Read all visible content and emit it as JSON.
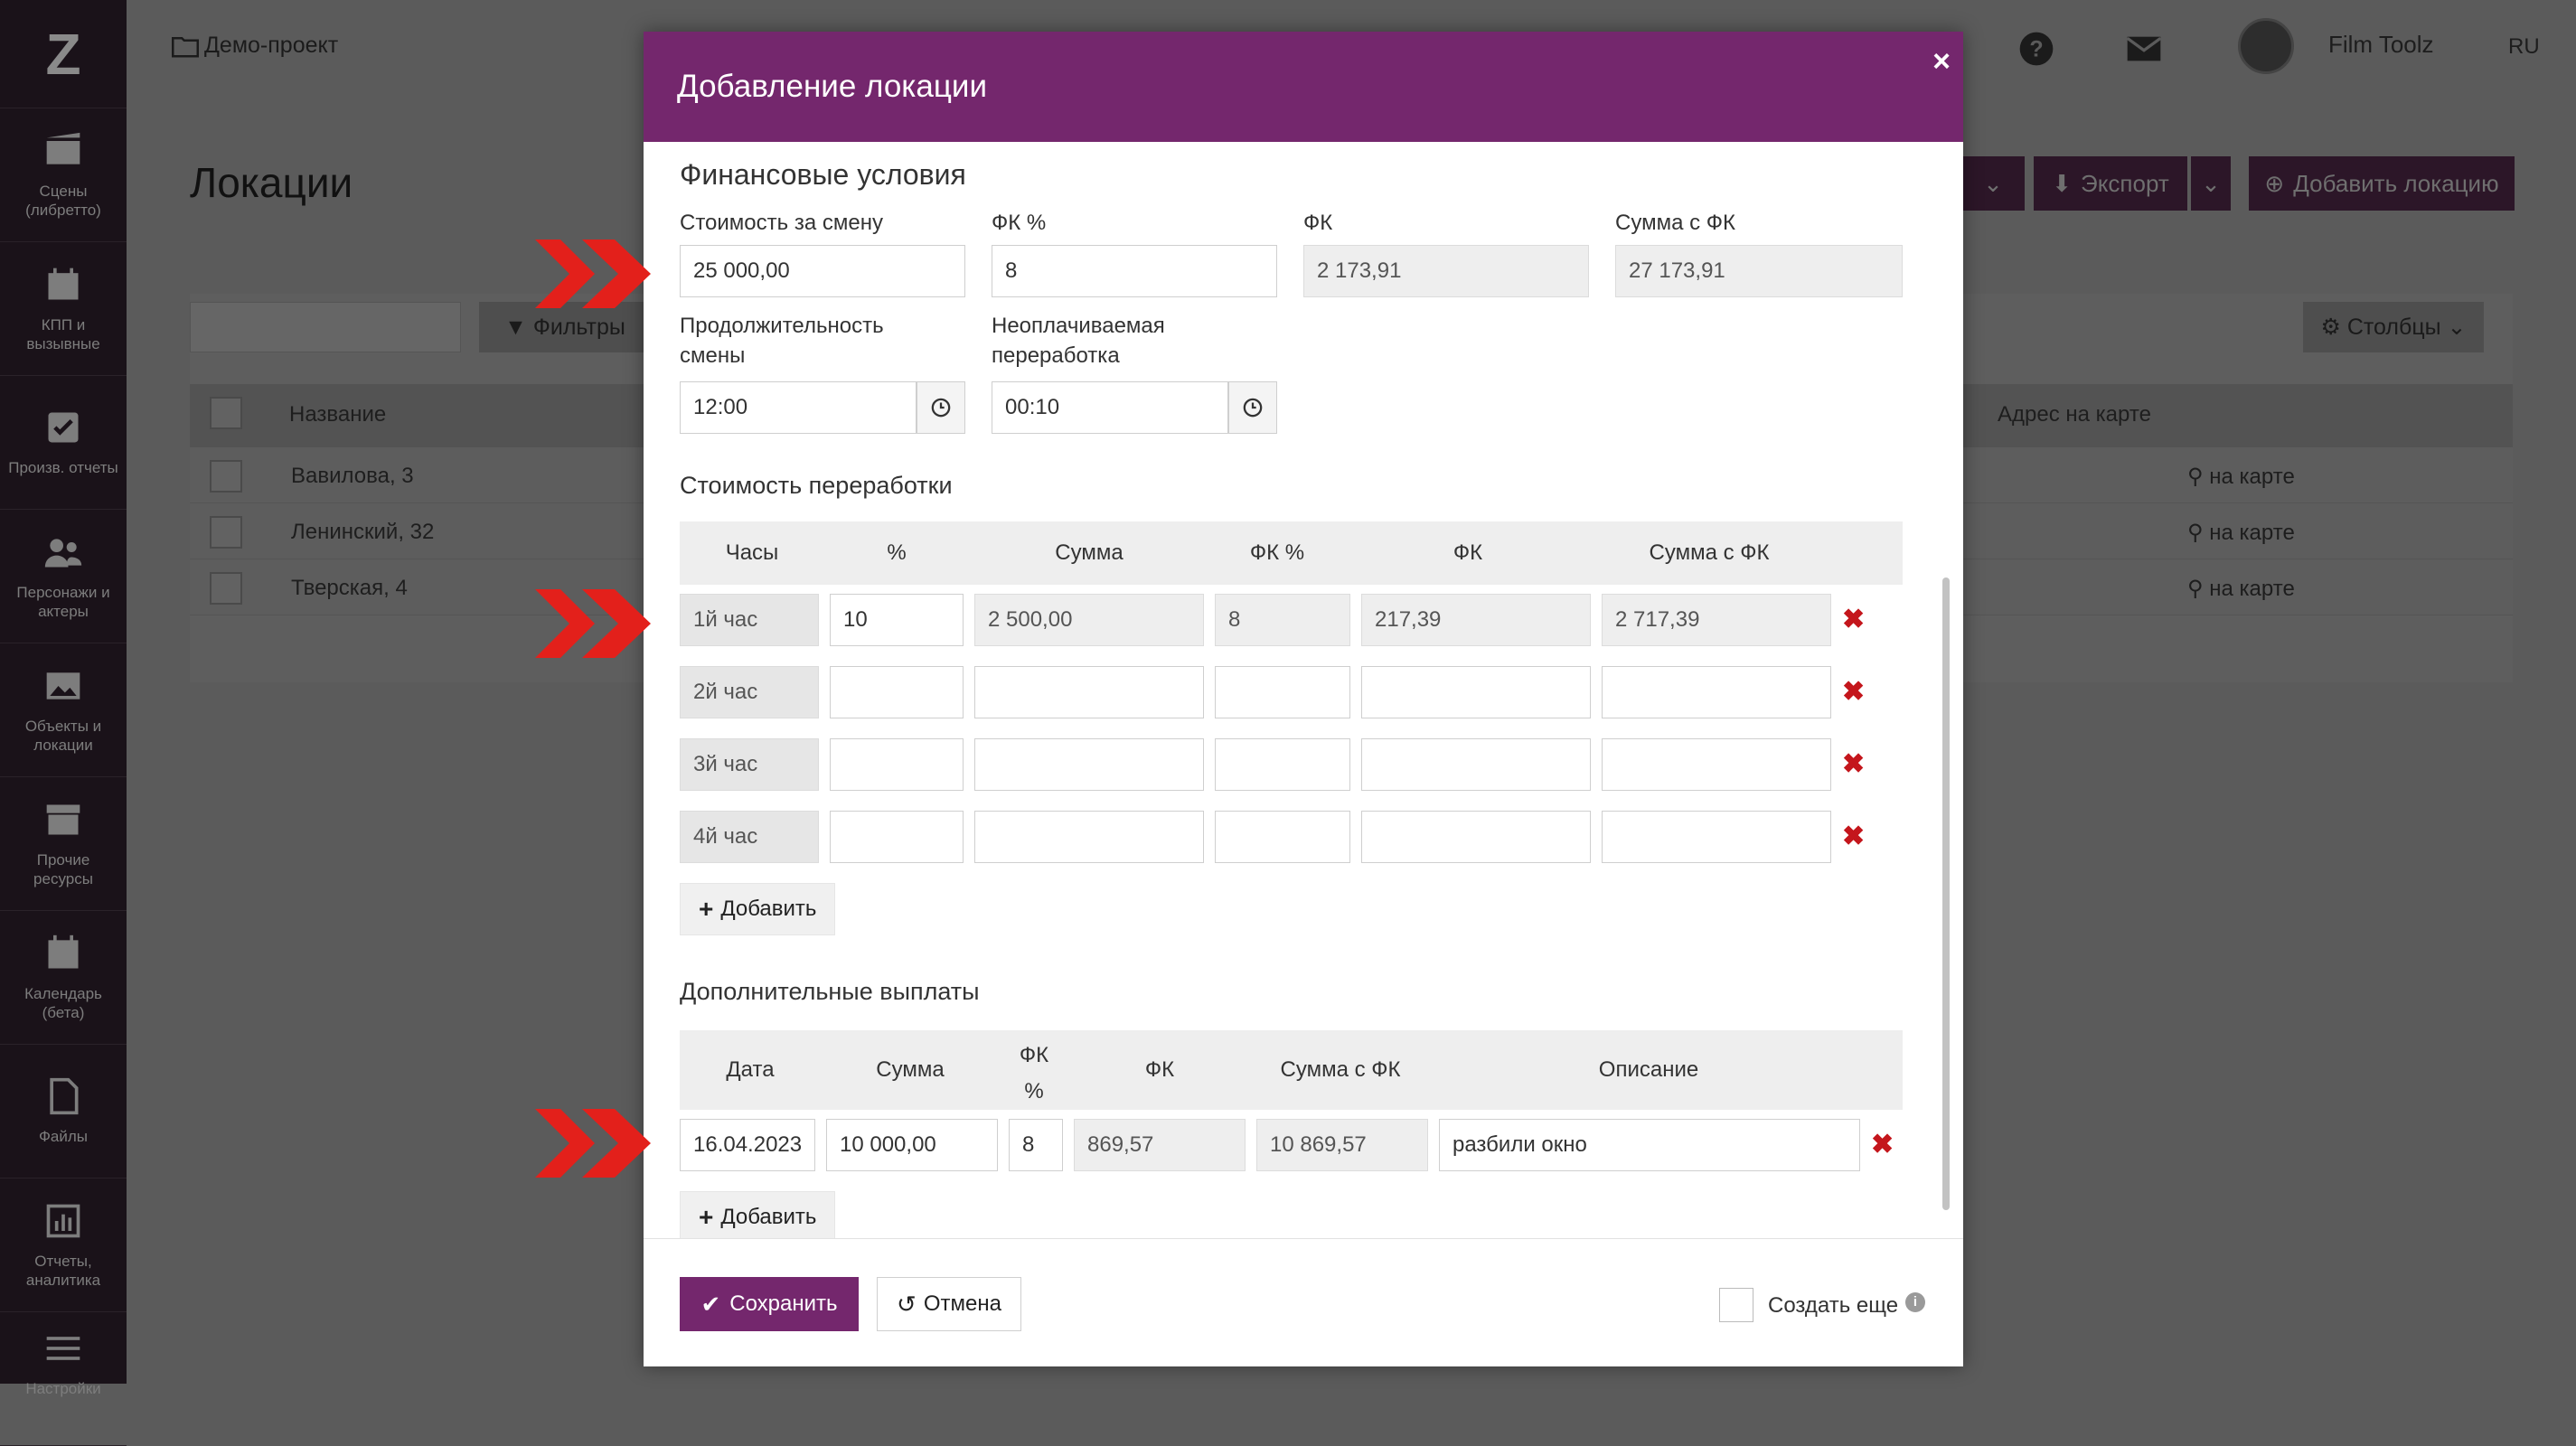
{
  "sidebar": {
    "logo": "Z",
    "items": [
      {
        "label": "Сцены (либретто)",
        "icon": "film-icon"
      },
      {
        "label": "КПП и вызывные",
        "icon": "calendar-icon"
      },
      {
        "label": "Произв. отчеты",
        "icon": "checkbox-icon"
      },
      {
        "label": "Персонажи и актеры",
        "icon": "users-icon"
      },
      {
        "label": "Объекты и локации",
        "icon": "image-icon"
      },
      {
        "label": "Прочие ресурсы",
        "icon": "archive-icon"
      },
      {
        "label": "Календарь (бета)",
        "icon": "calendar-grid-icon"
      },
      {
        "label": "Файлы",
        "icon": "file-icon"
      },
      {
        "label": "Отчеты, аналитика",
        "icon": "bar-chart-icon"
      },
      {
        "label": "Настройки",
        "icon": "sliders-icon"
      }
    ]
  },
  "topbar": {
    "project": "Демо-проект",
    "user": "Film Toolz",
    "lang": "RU"
  },
  "background": {
    "page_title": "Локации",
    "export_label": "Экспорт",
    "add_location_label": "Добавить локацию",
    "filter_label": "Фильтры",
    "columns_label": "Столбцы",
    "header_name": "Название",
    "header_address": "Адрес на карте",
    "rows": [
      {
        "name": "Вавилова, 3",
        "map": "на карте"
      },
      {
        "name": "Ленинский, 32",
        "map": "на карте"
      },
      {
        "name": "Тверская, 4",
        "map": "на карте"
      }
    ]
  },
  "modal": {
    "title": "Добавление локации",
    "close": "×",
    "finance": {
      "title": "Финансовые условия",
      "shift_cost_label": "Стоимость за смену",
      "shift_cost_value": "25 000,00",
      "fk_percent_label": "ФК %",
      "fk_percent_value": "8",
      "fk_label": "ФК",
      "fk_value": "2 173,91",
      "sum_fk_label": "Сумма с ФК",
      "sum_fk_value": "27 173,91",
      "duration_label_1": "Продолжительность",
      "duration_label_2": "смены",
      "duration_value": "12:00",
      "unpaid_label_1": "Неоплачиваемая",
      "unpaid_label_2": "переработка",
      "unpaid_value": "00:10"
    },
    "overtime": {
      "title": "Стоимость переработки",
      "headers": [
        "Часы",
        "%",
        "Сумма",
        "ФК %",
        "ФК",
        "Сумма с ФК"
      ],
      "rows": [
        {
          "hour": "1й час",
          "percent": "10",
          "sum": "2 500,00",
          "fk_percent": "8",
          "fk": "217,39",
          "sum_fk": "2 717,39"
        },
        {
          "hour": "2й час",
          "percent": "",
          "sum": "",
          "fk_percent": "",
          "fk": "",
          "sum_fk": ""
        },
        {
          "hour": "3й час",
          "percent": "",
          "sum": "",
          "fk_percent": "",
          "fk": "",
          "sum_fk": ""
        },
        {
          "hour": "4й час",
          "percent": "",
          "sum": "",
          "fk_percent": "",
          "fk": "",
          "sum_fk": ""
        }
      ],
      "add_label": "Добавить"
    },
    "extra": {
      "title": "Дополнительные выплаты",
      "headers": {
        "date": "Дата",
        "sum": "Сумма",
        "fk_percent_1": "ФК",
        "fk_percent_2": "%",
        "fk": "ФК",
        "sum_fk": "Сумма с ФК",
        "description": "Описание"
      },
      "row": {
        "date": "16.04.2023",
        "sum": "10 000,00",
        "fk_percent": "8",
        "fk": "869,57",
        "sum_fk": "10 869,57",
        "description": "разбили окно"
      },
      "add_label": "Добавить"
    },
    "footer": {
      "save_label": "Сохранить",
      "cancel_label": "Отмена",
      "create_more_label": "Создать еще"
    }
  },
  "colors": {
    "accent": "#74276d",
    "delete": "#c4161c",
    "arrow": "#e3201b"
  }
}
